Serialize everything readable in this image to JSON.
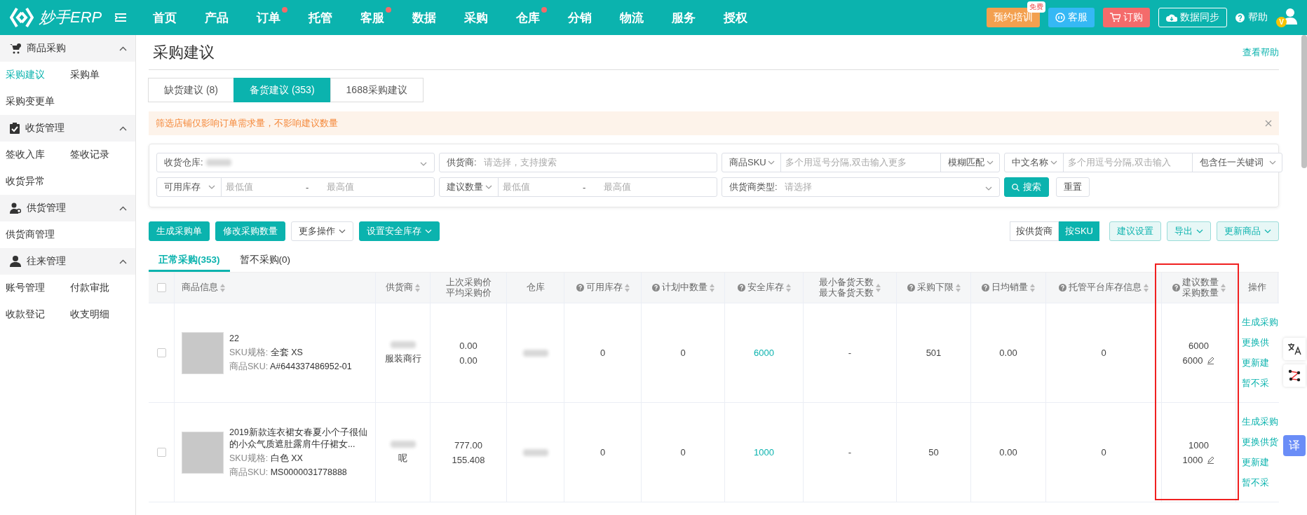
{
  "brand": {
    "name": "妙手ERP"
  },
  "nav": [
    {
      "label": "首页",
      "badge": false
    },
    {
      "label": "产品",
      "badge": false
    },
    {
      "label": "订单",
      "badge": true
    },
    {
      "label": "托管",
      "badge": false
    },
    {
      "label": "客服",
      "badge": true
    },
    {
      "label": "数据",
      "badge": false
    },
    {
      "label": "采购",
      "badge": false
    },
    {
      "label": "仓库",
      "badge": true
    },
    {
      "label": "分销",
      "badge": false
    },
    {
      "label": "物流",
      "badge": false
    },
    {
      "label": "服务",
      "badge": false
    },
    {
      "label": "授权",
      "badge": false
    }
  ],
  "header_actions": {
    "training": "预约培训",
    "free_tag": "免费",
    "service": "客服",
    "order": "订购",
    "sync": "数据同步",
    "help": "帮助",
    "vip": "V"
  },
  "sidebar": [
    {
      "title": "商品采购",
      "expanded": true,
      "items": [
        {
          "label": "采购建议",
          "selected": true
        },
        {
          "label": "采购单",
          "selected": false
        },
        {
          "label": "采购变更单",
          "selected": false
        }
      ]
    },
    {
      "title": "收货管理",
      "expanded": true,
      "items": [
        {
          "label": "签收入库",
          "selected": false
        },
        {
          "label": "签收记录",
          "selected": false
        },
        {
          "label": "收货异常",
          "selected": false
        }
      ]
    },
    {
      "title": "供货管理",
      "expanded": true,
      "items": [
        {
          "label": "供货商管理",
          "selected": false
        }
      ]
    },
    {
      "title": "往来管理",
      "expanded": true,
      "items": [
        {
          "label": "账号管理",
          "selected": false
        },
        {
          "label": "付款审批",
          "selected": false
        },
        {
          "label": "收款登记",
          "selected": false
        },
        {
          "label": "收支明细",
          "selected": false
        }
      ]
    }
  ],
  "page": {
    "title": "采购建议",
    "help_link": "查看帮助"
  },
  "tabs": [
    {
      "label": "缺货建议 (8)",
      "selected": false
    },
    {
      "label": "备货建议 (353)",
      "selected": true
    },
    {
      "label": "1688采购建议",
      "selected": false
    }
  ],
  "alert": {
    "text": "筛选店铺仅影响订单需求量，不影响建议数量"
  },
  "filters": {
    "warehouse": {
      "label": "收货仓库:"
    },
    "supplier": {
      "label": "供货商:",
      "placeholder": "请选择，支持搜索"
    },
    "sku": {
      "field": "商品SKU",
      "placeholder": "多个用逗号分隔,双击输入更多",
      "mode": "模糊匹配"
    },
    "name": {
      "field": "中文名称",
      "placeholder": "多个用逗号分隔,双击输入",
      "mode": "包含任一关键词"
    },
    "stock": {
      "field": "可用库存",
      "min": "最低值",
      "max": "最高值",
      "dash": "-"
    },
    "quantity": {
      "field": "建议数量",
      "min": "最低值",
      "max": "最高值",
      "dash": "-"
    },
    "supplier_type": {
      "label": "供货商类型:",
      "placeholder": "请选择"
    },
    "search": "搜索",
    "reset": "重置"
  },
  "toolbar": {
    "left": [
      {
        "label": "生成采购单",
        "kind": "primary"
      },
      {
        "label": "修改采购数量",
        "kind": "primary"
      },
      {
        "label": "更多操作",
        "kind": "dropdown"
      },
      {
        "label": "设置安全库存",
        "kind": "primary-dropdown"
      }
    ],
    "view": [
      {
        "label": "按供货商",
        "selected": false
      },
      {
        "label": "按SKU",
        "selected": true
      }
    ],
    "right": [
      {
        "label": "建议设置",
        "kind": "light"
      },
      {
        "label": "导出",
        "kind": "light-dropdown"
      },
      {
        "label": "更新商品",
        "kind": "light-dropdown"
      }
    ]
  },
  "sub_tabs": [
    {
      "label": "正常采购(353)",
      "selected": true
    },
    {
      "label": "暂不采购(0)",
      "selected": false
    }
  ],
  "table": {
    "select_all_checked": false,
    "columns": [
      {
        "lines": [
          "商品信息"
        ],
        "help": false,
        "sort": true
      },
      {
        "lines": [
          "供货商"
        ],
        "help": false,
        "sort": true
      },
      {
        "lines": [
          "上次采购价",
          "平均采购价"
        ],
        "help": false,
        "sort": false
      },
      {
        "lines": [
          "仓库"
        ],
        "help": false,
        "sort": false
      },
      {
        "lines": [
          "可用库存"
        ],
        "help": true,
        "sort": true
      },
      {
        "lines": [
          "计划中数量"
        ],
        "help": true,
        "sort": true
      },
      {
        "lines": [
          "安全库存"
        ],
        "help": true,
        "sort": true
      },
      {
        "lines": [
          "最小备货天数",
          "最大备货天数"
        ],
        "help": false,
        "sort": true
      },
      {
        "lines": [
          "采购下限"
        ],
        "help": true,
        "sort": true
      },
      {
        "lines": [
          "日均销量"
        ],
        "help": true,
        "sort": true
      },
      {
        "lines": [
          "托管平台库存信息"
        ],
        "help": true,
        "sort": true
      },
      {
        "lines": [
          "建议数量",
          "采购数量"
        ],
        "help": true,
        "sort": true
      },
      {
        "lines": [
          "操作"
        ],
        "help": false,
        "sort": false
      }
    ],
    "rows": [
      {
        "checked": false,
        "title": "22",
        "spec_label": "SKU规格:",
        "spec": "全套 XS",
        "sku_label": "商品SKU:",
        "sku": "A#644337486952-01",
        "supplier": "服装商行",
        "prices": [
          "0.00",
          "0.00"
        ],
        "available": "0",
        "planned": "0",
        "safety": "6000",
        "days": "-",
        "lower": "501",
        "daily": "0.00",
        "hosted": "0",
        "suggested": "6000",
        "purchase": "6000",
        "actions": [
          "生成采购",
          "更换供",
          "更新建",
          "暂不采"
        ]
      },
      {
        "checked": false,
        "title": "2019新款连衣裙女春夏小个子很仙的小众气质遮肚露肩牛仔裙女...",
        "spec_label": "SKU规格:",
        "spec": "白色 XX",
        "sku_label": "商品SKU:",
        "sku": "MS0000031778888",
        "supplier": "呢",
        "prices": [
          "777.00",
          "155.408"
        ],
        "available": "0",
        "planned": "0",
        "safety": "1000",
        "days": "-",
        "lower": "50",
        "daily": "0.00",
        "hosted": "0",
        "suggested": "1000",
        "purchase": "1000",
        "actions": [
          "生成采购",
          "更换供货",
          "更新建",
          "暂不采"
        ]
      }
    ]
  },
  "float_tools": {
    "translate": "译"
  }
}
